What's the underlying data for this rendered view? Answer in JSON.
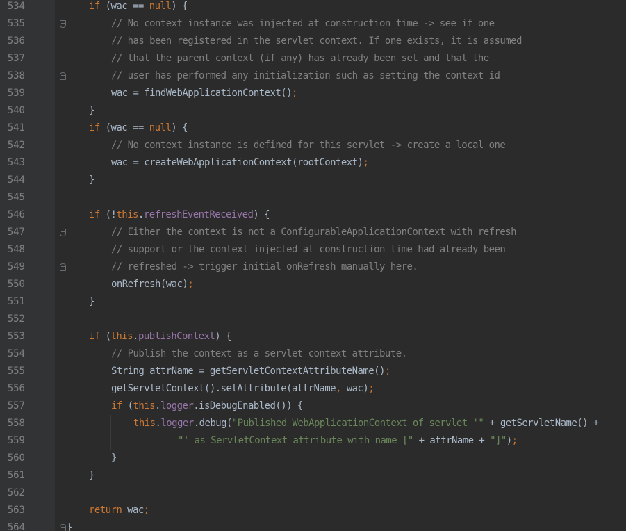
{
  "editor": {
    "colors": {
      "background": "#2b2b2b",
      "gutter": "#313335",
      "keyword": "#cc7832",
      "field": "#9876aa",
      "comment": "#808080",
      "string": "#6a8759",
      "text": "#a9b7c6",
      "line_number": "#7f8184"
    },
    "lines": [
      {
        "num": "534",
        "indent": 2,
        "fold": "",
        "segs": [
          [
            "k",
            "if"
          ],
          [
            "t",
            " (wac == "
          ],
          [
            "k",
            "null"
          ],
          [
            "t",
            ") {"
          ]
        ]
      },
      {
        "num": "535",
        "indent": 3,
        "fold": "start",
        "segs": [
          [
            "c",
            "// No context instance was injected at construction time -> see if one"
          ]
        ]
      },
      {
        "num": "536",
        "indent": 3,
        "fold": "",
        "segs": [
          [
            "c",
            "// has been registered in the servlet context. If one exists, it is assumed"
          ]
        ]
      },
      {
        "num": "537",
        "indent": 3,
        "fold": "",
        "segs": [
          [
            "c",
            "// that the parent context (if any) has already been set and that the"
          ]
        ]
      },
      {
        "num": "538",
        "indent": 3,
        "fold": "end",
        "segs": [
          [
            "c",
            "// user has performed any initialization such as setting the context id"
          ]
        ]
      },
      {
        "num": "539",
        "indent": 3,
        "fold": "",
        "segs": [
          [
            "t",
            "wac = findWebApplicationContext()"
          ],
          [
            "p",
            ";"
          ]
        ]
      },
      {
        "num": "540",
        "indent": 2,
        "fold": "",
        "segs": [
          [
            "t",
            "}"
          ]
        ]
      },
      {
        "num": "541",
        "indent": 2,
        "fold": "",
        "segs": [
          [
            "k",
            "if"
          ],
          [
            "t",
            " (wac == "
          ],
          [
            "k",
            "null"
          ],
          [
            "t",
            ") {"
          ]
        ]
      },
      {
        "num": "542",
        "indent": 3,
        "fold": "",
        "segs": [
          [
            "c",
            "// No context instance is defined for this servlet -> create a local one"
          ]
        ]
      },
      {
        "num": "543",
        "indent": 3,
        "fold": "",
        "segs": [
          [
            "t",
            "wac = createWebApplicationContext(rootContext)"
          ],
          [
            "p",
            ";"
          ]
        ]
      },
      {
        "num": "544",
        "indent": 2,
        "fold": "",
        "segs": [
          [
            "t",
            "}"
          ]
        ]
      },
      {
        "num": "545",
        "indent": 0,
        "fold": "",
        "segs": []
      },
      {
        "num": "546",
        "indent": 2,
        "fold": "",
        "segs": [
          [
            "k",
            "if"
          ],
          [
            "t",
            " (!"
          ],
          [
            "k",
            "this"
          ],
          [
            "t",
            "."
          ],
          [
            "f",
            "refreshEventReceived"
          ],
          [
            "t",
            ") {"
          ]
        ]
      },
      {
        "num": "547",
        "indent": 3,
        "fold": "start",
        "segs": [
          [
            "c",
            "// Either the context is not a ConfigurableApplicationContext with refresh"
          ]
        ]
      },
      {
        "num": "548",
        "indent": 3,
        "fold": "",
        "segs": [
          [
            "c",
            "// support or the context injected at construction time had already been"
          ]
        ]
      },
      {
        "num": "549",
        "indent": 3,
        "fold": "end",
        "segs": [
          [
            "c",
            "// refreshed -> trigger initial onRefresh manually here."
          ]
        ]
      },
      {
        "num": "550",
        "indent": 3,
        "fold": "",
        "segs": [
          [
            "t",
            "onRefresh(wac)"
          ],
          [
            "p",
            ";"
          ]
        ]
      },
      {
        "num": "551",
        "indent": 2,
        "fold": "",
        "segs": [
          [
            "t",
            "}"
          ]
        ]
      },
      {
        "num": "552",
        "indent": 0,
        "fold": "",
        "segs": []
      },
      {
        "num": "553",
        "indent": 2,
        "fold": "",
        "segs": [
          [
            "k",
            "if"
          ],
          [
            "t",
            " ("
          ],
          [
            "k",
            "this"
          ],
          [
            "t",
            "."
          ],
          [
            "f",
            "publishContext"
          ],
          [
            "t",
            ") {"
          ]
        ]
      },
      {
        "num": "554",
        "indent": 3,
        "fold": "",
        "segs": [
          [
            "c",
            "// Publish the context as a servlet context attribute."
          ]
        ]
      },
      {
        "num": "555",
        "indent": 3,
        "fold": "",
        "segs": [
          [
            "t",
            "String attrName = getServletContextAttributeName()"
          ],
          [
            "p",
            ";"
          ]
        ]
      },
      {
        "num": "556",
        "indent": 3,
        "fold": "",
        "segs": [
          [
            "t",
            "getServletContext().setAttribute(attrName"
          ],
          [
            "p",
            ","
          ],
          [
            "t",
            " wac)"
          ],
          [
            "p",
            ";"
          ]
        ]
      },
      {
        "num": "557",
        "indent": 3,
        "fold": "",
        "segs": [
          [
            "k",
            "if"
          ],
          [
            "t",
            " ("
          ],
          [
            "k",
            "this"
          ],
          [
            "t",
            "."
          ],
          [
            "f",
            "logger"
          ],
          [
            "t",
            ".isDebugEnabled()) {"
          ]
        ]
      },
      {
        "num": "558",
        "indent": 4,
        "fold": "",
        "segs": [
          [
            "k",
            "this"
          ],
          [
            "t",
            "."
          ],
          [
            "f",
            "logger"
          ],
          [
            "t",
            ".debug("
          ],
          [
            "s",
            "\"Published WebApplicationContext of servlet '\""
          ],
          [
            "t",
            " + getServletName() +"
          ]
        ]
      },
      {
        "num": "559",
        "indent": 6,
        "fold": "",
        "segs": [
          [
            "s",
            "\"' as ServletContext attribute with name [\""
          ],
          [
            "t",
            " + attrName + "
          ],
          [
            "s",
            "\"]\""
          ],
          [
            "t",
            ")"
          ],
          [
            "p",
            ";"
          ]
        ]
      },
      {
        "num": "560",
        "indent": 3,
        "fold": "",
        "segs": [
          [
            "t",
            "}"
          ]
        ]
      },
      {
        "num": "561",
        "indent": 2,
        "fold": "",
        "segs": [
          [
            "t",
            "}"
          ]
        ]
      },
      {
        "num": "562",
        "indent": 0,
        "fold": "",
        "segs": []
      },
      {
        "num": "563",
        "indent": 2,
        "fold": "",
        "segs": [
          [
            "k",
            "return"
          ],
          [
            "t",
            " wac"
          ],
          [
            "p",
            ";"
          ]
        ]
      },
      {
        "num": "564",
        "indent": 1,
        "fold": "end",
        "segs": [
          [
            "t",
            "}"
          ]
        ]
      }
    ]
  }
}
